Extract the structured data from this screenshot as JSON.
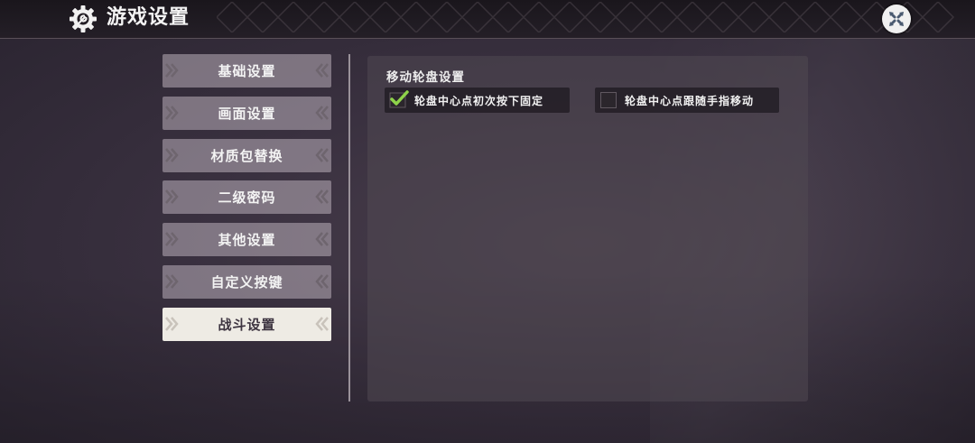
{
  "header": {
    "title": "游戏设置",
    "icons": {
      "settings": "gear-wrench-icon",
      "close": "close-icon"
    }
  },
  "sidebar": {
    "items": [
      {
        "label": "基础设置",
        "active": false
      },
      {
        "label": "画面设置",
        "active": false
      },
      {
        "label": "材质包替换",
        "active": false
      },
      {
        "label": "二级密码",
        "active": false
      },
      {
        "label": "其他设置",
        "active": false
      },
      {
        "label": "自定义按键",
        "active": false
      },
      {
        "label": "战斗设置",
        "active": true
      }
    ]
  },
  "panel": {
    "section_title": "移动轮盘设置",
    "options": [
      {
        "label": "轮盘中心点初次按下固定",
        "checked": true
      },
      {
        "label": "轮盘中心点跟随手指移动",
        "checked": false
      }
    ]
  },
  "colors": {
    "check_green": "#8ed34a",
    "active_tab_bg": "#eeebe4",
    "tab_bg": "#a89fa8"
  }
}
